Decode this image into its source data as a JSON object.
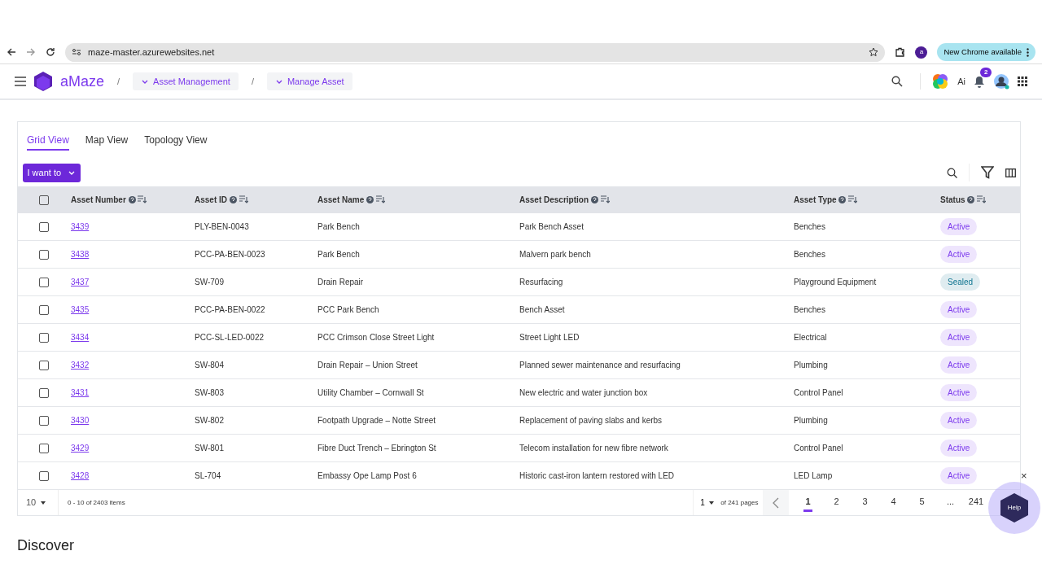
{
  "browser": {
    "url": "maze-master.azurewebsites.net",
    "profile_initial": "a",
    "update_label": "New Chrome available"
  },
  "header": {
    "brand": "aMaze",
    "breadcrumbs": [
      {
        "separator": "/",
        "label": "Asset Management"
      },
      {
        "separator": "/",
        "label": "Manage Asset"
      }
    ],
    "ai_label": "Ai",
    "notification_count": "2"
  },
  "tabs": [
    {
      "label": "Grid View",
      "selected": true
    },
    {
      "label": "Map View",
      "selected": false
    },
    {
      "label": "Topology View",
      "selected": false
    }
  ],
  "action_button": "I want to",
  "table": {
    "select_all_checked": false,
    "columns": [
      "Asset Number",
      "Asset ID",
      "Asset Name",
      "Asset Description",
      "Asset Type",
      "Status"
    ],
    "rows": [
      {
        "number": "3439",
        "id": "PLY-BEN-0043",
        "name": "Park Bench",
        "description": "Park Bench Asset",
        "type": "Benches",
        "status": "Active",
        "color": "#7c3aed",
        "checked": false
      },
      {
        "number": "3438",
        "id": "PCC-PA-BEN-0023",
        "name": "Park Bench",
        "description": "Malvern park bench",
        "type": "Benches",
        "status": "Active",
        "color": "#7c3aed",
        "checked": false
      },
      {
        "number": "3437",
        "id": "SW-709",
        "name": "Drain Repair",
        "description": "Resurfacing",
        "type": "Playground Equipment",
        "status": "Sealed",
        "color": "#0e7490",
        "checked": false
      },
      {
        "number": "3435",
        "id": "PCC-PA-BEN-0022",
        "name": "PCC Park Bench",
        "description": "Bench Asset",
        "type": "Benches",
        "status": "Active",
        "color": "#7c3aed",
        "checked": false
      },
      {
        "number": "3434",
        "id": "PCC-SL-LED-0022",
        "name": "PCC Crimson Close Street Light",
        "description": "Street Light LED",
        "type": "Electrical",
        "status": "Active",
        "color": "#7c3aed",
        "checked": false
      },
      {
        "number": "3432",
        "id": "SW-804",
        "name": "Drain Repair – Union Street",
        "description": "Planned sewer maintenance and resurfacing",
        "type": "Plumbing",
        "status": "Active",
        "color": "#7c3aed",
        "checked": false
      },
      {
        "number": "3431",
        "id": "SW-803",
        "name": "Utility Chamber – Cornwall St",
        "description": "New electric and water junction box",
        "type": "Control Panel",
        "status": "Active",
        "color": "#7c3aed",
        "checked": false
      },
      {
        "number": "3430",
        "id": "SW-802",
        "name": "Footpath Upgrade – Notte Street",
        "description": "Replacement of paving slabs and kerbs",
        "type": "Plumbing",
        "status": "Active",
        "color": "#7c3aed",
        "checked": false
      },
      {
        "number": "3429",
        "id": "SW-801",
        "name": "Fibre Duct Trench – Ebrington St",
        "description": "Telecom installation for new fibre network",
        "type": "Control Panel",
        "status": "Active",
        "color": "#7c3aed",
        "checked": false
      },
      {
        "number": "3428",
        "id": "SL-704",
        "name": "Embassy Ope Lamp Post 6",
        "description": "Historic cast-iron lantern restored with LED",
        "type": "LED Lamp",
        "status": "Active",
        "color": "#7c3aed",
        "checked": false
      }
    ]
  },
  "pager": {
    "page_size": "10",
    "range": "0 - 10 of 2403 items",
    "page_select": "1",
    "page_total": "of 241 pages",
    "pages": [
      {
        "label": "1",
        "selected": true
      },
      {
        "label": "2",
        "selected": false
      },
      {
        "label": "3",
        "selected": false
      },
      {
        "label": "4",
        "selected": false
      },
      {
        "label": "5",
        "selected": false
      },
      {
        "label": "...",
        "selected": false
      },
      {
        "label": "241",
        "selected": false
      }
    ]
  },
  "section_heading": "Discover",
  "help": {
    "label": "Help",
    "close": "×"
  }
}
